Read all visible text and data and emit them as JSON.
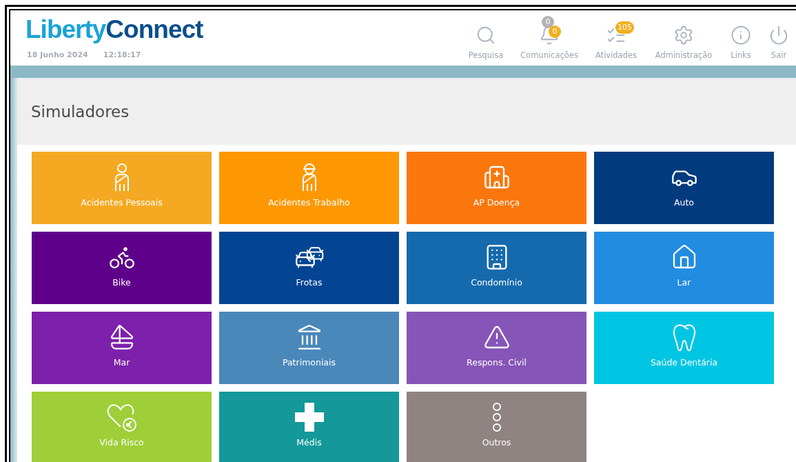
{
  "logo": {
    "first": "Liberty",
    "second": "Connect"
  },
  "date": "18 Junho 2024",
  "time": "12:18:17",
  "nav": [
    {
      "label": "Pesquisa"
    },
    {
      "label": "Comunicações",
      "badges": [
        {
          "text": "0",
          "color": "#b3b3b3"
        },
        {
          "text": "0",
          "color": "#f2b01e"
        }
      ]
    },
    {
      "label": "Atividades",
      "badges": [
        {
          "text": "105",
          "color": "#f2b01e"
        }
      ]
    },
    {
      "label": "Administração"
    },
    {
      "label": "Links"
    },
    {
      "label": "Sair"
    }
  ],
  "page_title": "Simuladores",
  "tiles": [
    {
      "label": "Acidentes Pessoais",
      "color": "#f5a922"
    },
    {
      "label": "Acidentes Trabalho",
      "color": "#fd9802"
    },
    {
      "label": "AP Doença",
      "color": "#fb770d"
    },
    {
      "label": "Auto",
      "color": "#023b7e"
    },
    {
      "label": "Bike",
      "color": "#5e008a"
    },
    {
      "label": "Frotas",
      "color": "#034593"
    },
    {
      "label": "Condomínio",
      "color": "#156aad"
    },
    {
      "label": "Lar",
      "color": "#218ce0"
    },
    {
      "label": "Mar",
      "color": "#7d20ab"
    },
    {
      "label": "Patrimoniais",
      "color": "#4a88ba"
    },
    {
      "label": "Respons. Civil",
      "color": "#8655b8"
    },
    {
      "label": "Saúde Dentária",
      "color": "#00c5e3"
    },
    {
      "label": "Vida Risco",
      "color": "#9ecf38"
    },
    {
      "label": "Médis",
      "color": "#14989a"
    },
    {
      "label": "Outros",
      "color": "#8f8482"
    }
  ]
}
